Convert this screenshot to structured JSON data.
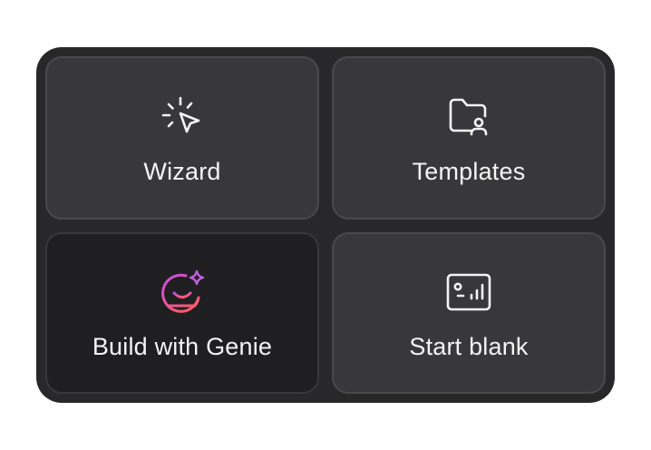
{
  "options": [
    {
      "id": "wizard",
      "label": "Wizard",
      "icon": "cursor-click-icon"
    },
    {
      "id": "templates",
      "label": "Templates",
      "icon": "folder-user-icon"
    },
    {
      "id": "genie",
      "label": "Build with Genie",
      "icon": "genie-chat-sparkle-icon",
      "selected": true,
      "icon_gradient": [
        "#c74ce6",
        "#ff5a6e"
      ]
    },
    {
      "id": "blank",
      "label": "Start blank",
      "icon": "dashboard-blank-icon"
    }
  ],
  "colors": {
    "panel_bg": "#28282b",
    "card_bg": "#38383c",
    "card_selected_bg": "#1f1f21",
    "card_border": "#48484d",
    "text": "#f4f4f5"
  }
}
